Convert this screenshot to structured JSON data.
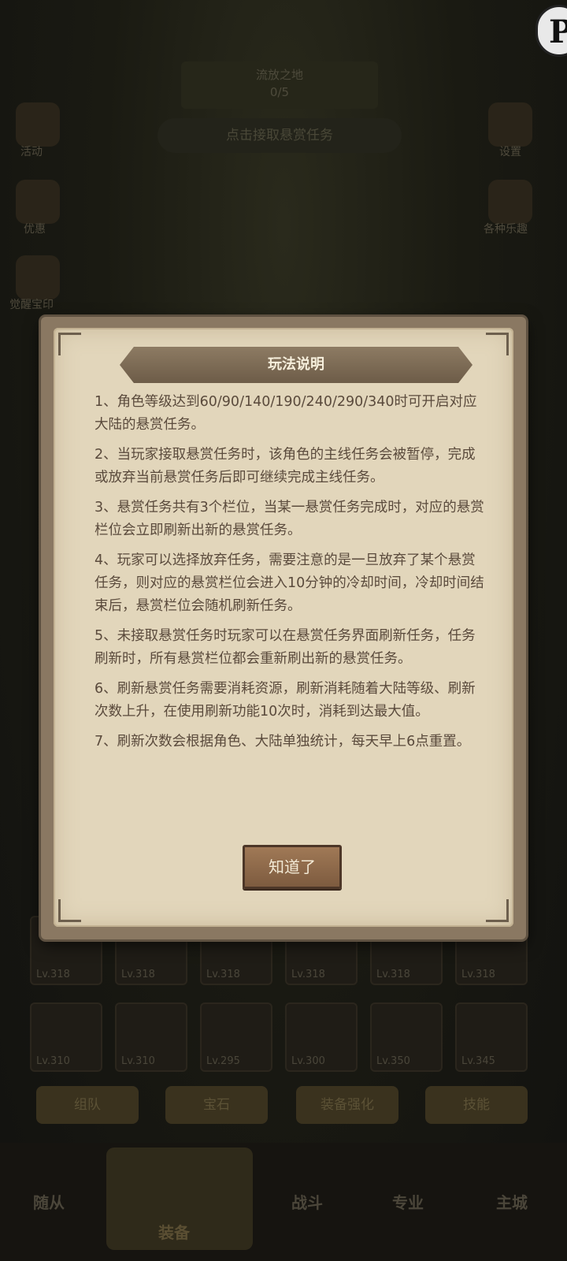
{
  "background": {
    "region": {
      "name": "流放之地",
      "progress": "0/5"
    },
    "bounty_prompt": "点击接取悬赏任务",
    "left_menu": [
      "活动",
      "优惠",
      "觉醒宝印"
    ],
    "right_menu": [
      "设置",
      "各种乐趣"
    ],
    "cards_row1": [
      "Lv.318",
      "Lv.318",
      "Lv.318",
      "Lv.318",
      "Lv.318",
      "Lv.318"
    ],
    "cards_row2": [
      "Lv.310",
      "Lv.310",
      "Lv.295",
      "Lv.300",
      "Lv.350",
      "Lv.345"
    ],
    "buttons": [
      "组队",
      "宝石",
      "装备强化",
      "技能"
    ],
    "nav": {
      "followers": "随从",
      "equipment": "装备",
      "battle": "战斗",
      "profession": "专业",
      "city": "主城"
    }
  },
  "dialog": {
    "title": "玩法说明",
    "rules": [
      "1、角色等级达到60/90/140/190/240/290/340时可开启对应大陆的悬赏任务。",
      "2、当玩家接取悬赏任务时，该角色的主线任务会被暂停，完成或放弃当前悬赏任务后即可继续完成主线任务。",
      "3、悬赏任务共有3个栏位，当某一悬赏任务完成时，对应的悬赏栏位会立即刷新出新的悬赏任务。",
      "4、玩家可以选择放弃任务，需要注意的是一旦放弃了某个悬赏任务，则对应的悬赏栏位会进入10分钟的冷却时间，冷却时间结束后，悬赏栏位会随机刷新任务。",
      "5、未接取悬赏任务时玩家可以在悬赏任务界面刷新任务，任务刷新时，所有悬赏栏位都会重新刷出新的悬赏任务。",
      "6、刷新悬赏任务需要消耗资源，刷新消耗随着大陆等级、刷新次数上升，在使用刷新功能10次时，消耗到达最大值。",
      "7、刷新次数会根据角色、大陆单独统计，每天早上6点重置。"
    ],
    "confirm_label": "知道了"
  }
}
